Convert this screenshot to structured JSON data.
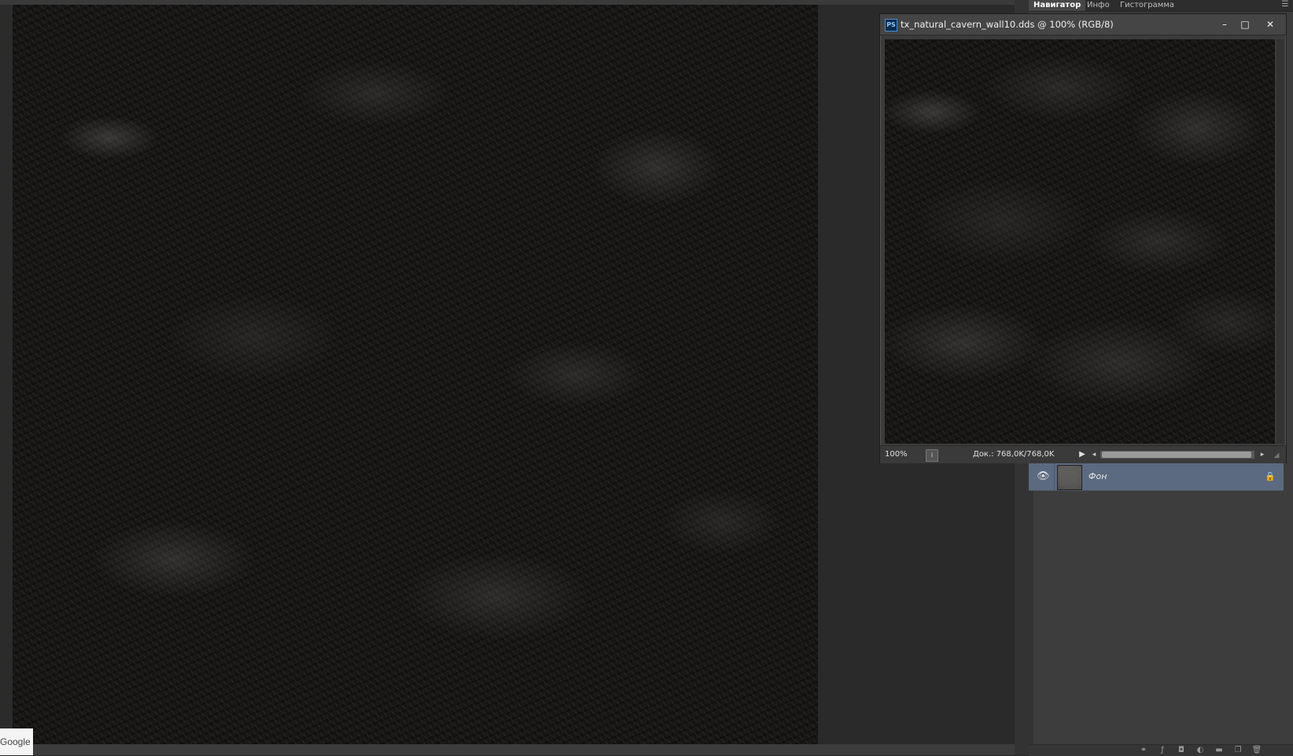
{
  "panel": {
    "tabs": [
      {
        "label": "Навигатор",
        "active": true
      },
      {
        "label": "Инфо",
        "active": false
      },
      {
        "label": "Гистограмма",
        "active": false
      }
    ],
    "menu_icon": "panel-menu-icon"
  },
  "document": {
    "title": "tx_natural_cavern_wall10.dds @ 100% (RGB/8)",
    "app_icon": "PS",
    "buttons": {
      "minimize": "–",
      "maximize": "□",
      "close": "✕"
    },
    "status": {
      "zoom": "100%",
      "doc_info": "Док.: 768,0K/768,0K"
    }
  },
  "layers": [
    {
      "name": "Фон",
      "visible": true,
      "locked": true,
      "selected": true
    }
  ],
  "overlay": {
    "watermark": "Google"
  },
  "colors": {
    "workspace": "#2a2a2a",
    "panel": "#3c3c3c",
    "selected_layer": "#5b6a80",
    "ps_icon_border": "#3d8fd6"
  }
}
